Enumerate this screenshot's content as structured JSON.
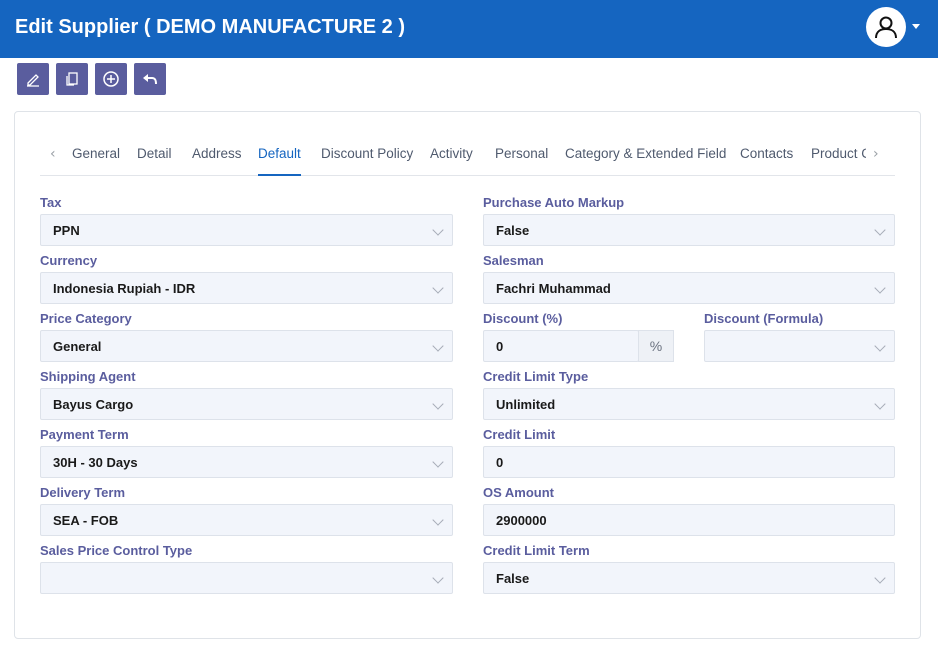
{
  "header": {
    "title": "Edit Supplier ( DEMO MANUFACTURE 2 )"
  },
  "toolbar": {
    "icons": [
      "edit-icon",
      "copy-icon",
      "add-icon",
      "back-icon"
    ]
  },
  "tabs": [
    "General",
    "Detail",
    "Address",
    "Default",
    "Discount Policy",
    "Activity",
    "Personal",
    "Category & Extended Field",
    "Contacts",
    "Product C"
  ],
  "active_tab": "Default",
  "form": {
    "tax": {
      "label": "Tax",
      "value": "PPN"
    },
    "currency": {
      "label": "Currency",
      "value": "Indonesia Rupiah - IDR"
    },
    "price_category": {
      "label": "Price Category",
      "value": "General"
    },
    "shipping_agent": {
      "label": "Shipping Agent",
      "value": "Bayus Cargo"
    },
    "payment_term": {
      "label": "Payment Term",
      "value": "30H - 30 Days"
    },
    "delivery_term": {
      "label": "Delivery Term",
      "value": "SEA - FOB"
    },
    "sales_price_control_type": {
      "label": "Sales Price Control Type",
      "value": ""
    },
    "purchase_auto_markup": {
      "label": "Purchase Auto Markup",
      "value": "False"
    },
    "salesman": {
      "label": "Salesman",
      "value": "Fachri Muhammad"
    },
    "discount_pct": {
      "label": "Discount (%)",
      "value": "0",
      "suffix": "%"
    },
    "discount_formula": {
      "label": "Discount (Formula)",
      "value": ""
    },
    "credit_limit_type": {
      "label": "Credit Limit Type",
      "value": "Unlimited"
    },
    "credit_limit": {
      "label": "Credit Limit",
      "value": "0"
    },
    "os_amount": {
      "label": "OS Amount",
      "value": "2900000"
    },
    "credit_limit_term": {
      "label": "Credit Limit Term",
      "value": "False"
    }
  }
}
